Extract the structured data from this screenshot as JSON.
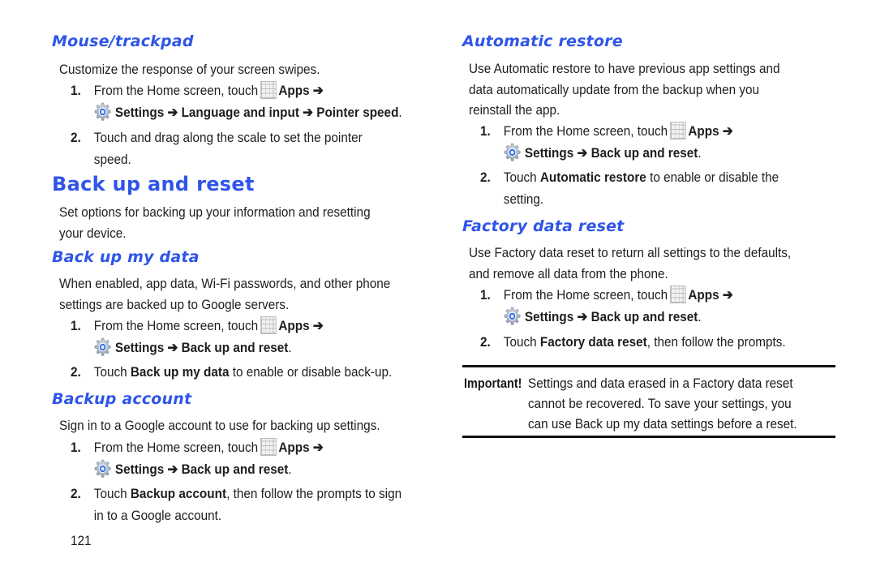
{
  "page_number": "121",
  "colors": {
    "heading_blue": "#2f55e8",
    "text": "#1e1e1e"
  },
  "icons": {
    "apps": "apps-grid-icon",
    "settings": "settings-gear-icon"
  },
  "left": {
    "mouse": {
      "heading": "Mouse/trackpad",
      "intro": "Customize the response of your screen swipes.",
      "step1_num": "1.",
      "step1_prefix": "From the Home screen, touch",
      "step1_apps": "Apps ➔",
      "step1_path": "Settings ➔ Language and input ➔ Pointer speed",
      "step1_end": ".",
      "step2_num": "2.",
      "step2_line1": "Touch and drag along the scale to set the pointer",
      "step2_line2": "speed."
    },
    "backup_reset": {
      "heading": "Back up and reset",
      "intro_line1": "Set options for backing up your information and resetting",
      "intro_line2": "your device."
    },
    "backup_my_data": {
      "heading": "Back up my data",
      "intro_line1": "When enabled, app data, Wi-Fi passwords, and other phone",
      "intro_line2": "settings are backed up to Google servers.",
      "step1_num": "1.",
      "step1_prefix": "From the Home screen, touch",
      "step1_apps": "Apps ➔",
      "step1_path": "Settings ➔ Back up and reset",
      "step1_end": ".",
      "step2_num": "2.",
      "step2_pre": "Touch ",
      "step2_bold": "Back up my data",
      "step2_post": " to enable or disable back-up."
    },
    "backup_account": {
      "heading": "Backup account",
      "intro": "Sign in to a Google account to use for backing up settings.",
      "step1_num": "1.",
      "step1_prefix": "From the Home screen, touch",
      "step1_apps": "Apps ➔",
      "step1_path": "Settings ➔ Back up and reset",
      "step1_end": ".",
      "step2_num": "2.",
      "step2_pre": "Touch ",
      "step2_bold": "Backup account",
      "step2_post": ", then follow the prompts to sign",
      "step2_line2": "in to a Google account."
    }
  },
  "right": {
    "auto_restore": {
      "heading": "Automatic restore",
      "intro_line1": "Use Automatic restore to have previous app settings and",
      "intro_line2": "data automatically update from the backup when you",
      "intro_line3": "reinstall the app.",
      "step1_num": "1.",
      "step1_prefix": "From the Home screen, touch",
      "step1_apps": "Apps ➔",
      "step1_path": "Settings ➔ Back up and reset",
      "step1_end": ".",
      "step2_num": "2.",
      "step2_pre": "Touch ",
      "step2_bold": "Automatic restore",
      "step2_post": " to enable or disable the",
      "step2_line2": "setting."
    },
    "factory_reset": {
      "heading": "Factory data reset",
      "intro_line1": "Use Factory data reset to return all settings to the defaults,",
      "intro_line2": "and remove all data from the phone.",
      "step1_num": "1.",
      "step1_prefix": "From the Home screen, touch",
      "step1_apps": "Apps ➔",
      "step1_path": "Settings ➔ Back up and reset",
      "step1_end": ".",
      "step2_num": "2.",
      "step2_pre": "Touch ",
      "step2_bold": "Factory data reset",
      "step2_post": ", then follow the prompts."
    },
    "important": {
      "label": "Important!",
      "line1": "Settings and data erased in a Factory data reset",
      "line2": "cannot be recovered. To save your settings, you",
      "line3": "can use Back up my data settings before a reset."
    }
  }
}
